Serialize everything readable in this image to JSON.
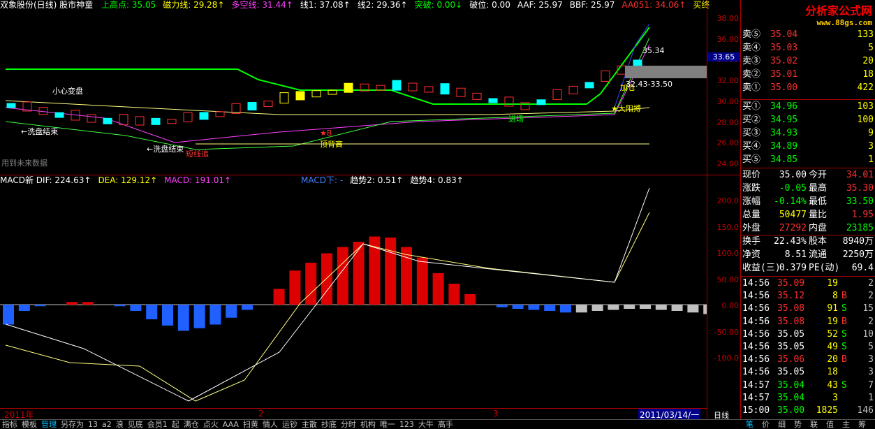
{
  "header": {
    "title": "双象股份(日线) 股市神童",
    "items": [
      {
        "label": "上高点: 35.05",
        "color": "#00ff00"
      },
      {
        "label": "磁力线: 29.28↑",
        "color": "#ffff00"
      },
      {
        "label": "多空线: 31.44↑",
        "color": "#ff40ff"
      },
      {
        "label": "线1: 37.08↑",
        "color": "#ffffff"
      },
      {
        "label": "线2: 29.36↑",
        "color": "#ffffff"
      },
      {
        "label": "突破: 0.00↓",
        "color": "#00ff00"
      },
      {
        "label": "破位: 0.00",
        "color": "#ffffff"
      },
      {
        "label": "AAF: 25.97",
        "color": "#ffffff"
      },
      {
        "label": "BBF: 25.97",
        "color": "#ffffff"
      },
      {
        "label": "AA051: 34.06↑",
        "color": "#ff3030"
      },
      {
        "label": "买终",
        "color": "#ffff00"
      }
    ]
  },
  "macd_header": {
    "items": [
      {
        "label": "MACD新 DIF: 224.63↑",
        "color": "#ffffff"
      },
      {
        "label": "DEA: 129.12↑",
        "color": "#ffff00"
      },
      {
        "label": "MACD: 191.01↑",
        "color": "#ff40ff"
      },
      {
        "label": "MACD下: -",
        "color": "#4080ff"
      },
      {
        "label": "趋势2: 0.51↑",
        "color": "#ffffff"
      },
      {
        "label": "趋势4: 0.83↑",
        "color": "#ffffff"
      }
    ]
  },
  "watermark": {
    "logo": "分析家公式网",
    "url": "www.88gs.com"
  },
  "price_axis": [
    "38.00",
    "36.00",
    "34.00",
    "32.00",
    "30.00",
    "28.00",
    "26.00",
    "24.00"
  ],
  "current_price_tag": "33.65",
  "macd_axis": [
    "200.0",
    "150.0",
    "100.0",
    "50.00",
    "0.00",
    "-50.00",
    "-100.0"
  ],
  "annotations": {
    "caution": "小心变盘",
    "wash_end1": "←洗盘结束",
    "wash_end2": "←洗盘结束",
    "enter": "进场",
    "add": "加仓",
    "big_yang": "★大阳搏",
    "chase": "短线追",
    "b_mark": "★B",
    "future": "用到未来数据",
    "bottom_high": "顶背高",
    "range": "32.43-33.50",
    "price_label": "35.34"
  },
  "time_axis": [
    "2011年",
    "2",
    "3"
  ],
  "date_tag": "2011/03/14/一",
  "period_tag": "日线",
  "order_book": {
    "asks": [
      {
        "label": "卖⑤",
        "price": "35.04",
        "vol": "133"
      },
      {
        "label": "卖④",
        "price": "35.03",
        "vol": "5"
      },
      {
        "label": "卖③",
        "price": "35.02",
        "vol": "20"
      },
      {
        "label": "卖②",
        "price": "35.01",
        "vol": "18"
      },
      {
        "label": "卖①",
        "price": "35.00",
        "vol": "422"
      }
    ],
    "bids": [
      {
        "label": "买①",
        "price": "34.96",
        "vol": "103"
      },
      {
        "label": "买②",
        "price": "34.95",
        "vol": "100"
      },
      {
        "label": "买③",
        "price": "34.93",
        "vol": "9"
      },
      {
        "label": "买④",
        "price": "34.89",
        "vol": "3"
      },
      {
        "label": "买⑤",
        "price": "34.85",
        "vol": "1"
      }
    ]
  },
  "quote": [
    {
      "k1": "现价",
      "v1": "35.00",
      "k2": "今开",
      "v2": "34.01",
      "c1": "#ffffff",
      "c2": "#ff3030"
    },
    {
      "k1": "涨跌",
      "v1": "-0.05",
      "k2": "最高",
      "v2": "35.30",
      "c1": "#00ff00",
      "c2": "#ff3030"
    },
    {
      "k1": "涨幅",
      "v1": "-0.14%",
      "k2": "最低",
      "v2": "33.50",
      "c1": "#00ff00",
      "c2": "#00ff00"
    },
    {
      "k1": "总量",
      "v1": "50477",
      "k2": "量比",
      "v2": "1.95",
      "c1": "#ffff00",
      "c2": "#ff3030"
    },
    {
      "k1": "外盘",
      "v1": "27292",
      "k2": "内盘",
      "v2": "23185",
      "c1": "#ff3030",
      "c2": "#00ff00"
    },
    {
      "k1": "换手",
      "v1": "22.43%",
      "k2": "股本",
      "v2": "8940万",
      "c1": "#ffffff",
      "c2": "#ffffff"
    },
    {
      "k1": "净资",
      "v1": "8.51",
      "k2": "流通",
      "v2": "2250万",
      "c1": "#ffffff",
      "c2": "#ffffff"
    },
    {
      "k1": "收益(三)",
      "v1": "0.379",
      "k2": "PE(动)",
      "v2": "69.4",
      "c1": "#ffffff",
      "c2": "#ffffff"
    }
  ],
  "ticks": [
    {
      "t": "14:56",
      "p": "35.09",
      "v": "19",
      "s": "",
      "n": "2",
      "pc": "#ff3030"
    },
    {
      "t": "14:56",
      "p": "35.12",
      "v": "8",
      "s": "B",
      "n": "2",
      "pc": "#ff3030"
    },
    {
      "t": "14:56",
      "p": "35.08",
      "v": "91",
      "s": "S",
      "n": "15",
      "pc": "#ff3030"
    },
    {
      "t": "14:56",
      "p": "35.08",
      "v": "19",
      "s": "B",
      "n": "2",
      "pc": "#ff3030"
    },
    {
      "t": "14:56",
      "p": "35.05",
      "v": "52",
      "s": "S",
      "n": "10",
      "pc": "#ffffff"
    },
    {
      "t": "14:56",
      "p": "35.05",
      "v": "49",
      "s": "S",
      "n": "5",
      "pc": "#ffffff"
    },
    {
      "t": "14:56",
      "p": "35.06",
      "v": "20",
      "s": "B",
      "n": "3",
      "pc": "#ff3030"
    },
    {
      "t": "14:56",
      "p": "35.05",
      "v": "18",
      "s": "",
      "n": "3",
      "pc": "#ffffff"
    },
    {
      "t": "14:57",
      "p": "35.04",
      "v": "43",
      "s": "S",
      "n": "7",
      "pc": "#00ff00"
    },
    {
      "t": "14:57",
      "p": "35.04",
      "v": "3",
      "s": "",
      "n": "1",
      "pc": "#00ff00"
    },
    {
      "t": "15:00",
      "p": "35.00",
      "v": "1825",
      "s": "",
      "n": "146",
      "pc": "#00ff00"
    }
  ],
  "bottom_tabs": [
    "指标",
    "模板",
    "管理",
    "另存为",
    "13",
    "a2",
    "浪",
    "见底",
    "会员1",
    "起",
    "满仓",
    "点火",
    "AAA",
    "扫黄",
    "情人",
    "运钞",
    "主散",
    "抄底",
    "分时",
    "机构",
    "唯一",
    "123",
    "大牛",
    "高手"
  ],
  "right_tabs": [
    "笔",
    "价",
    "细",
    "势",
    "联",
    "值",
    "主",
    "筹"
  ]
}
